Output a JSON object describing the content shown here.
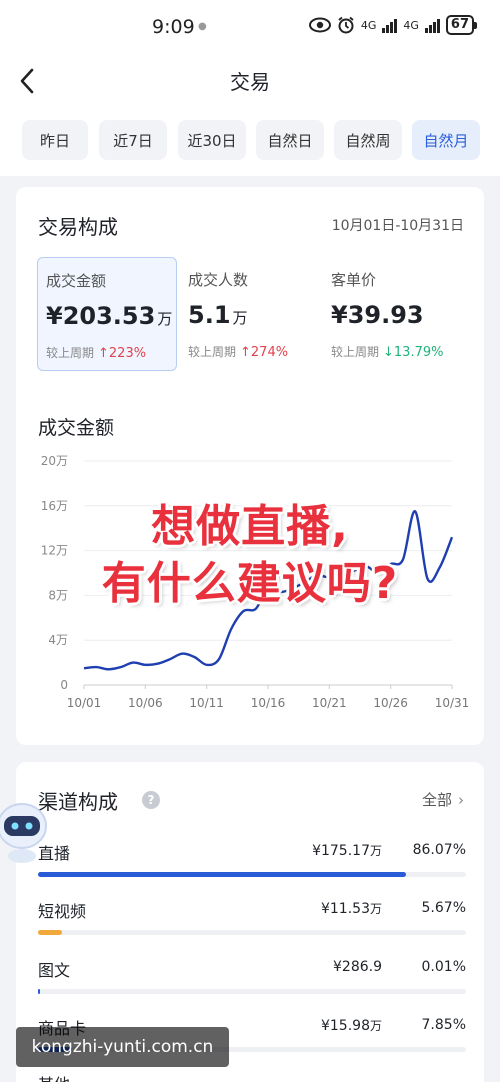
{
  "status_bar": {
    "time": "9:09",
    "signal_label_1": "4G",
    "signal_label_2": "4G",
    "battery": "67"
  },
  "header": {
    "title": "交易"
  },
  "tabs": [
    {
      "label": "昨日",
      "active": false
    },
    {
      "label": "近7日",
      "active": false
    },
    {
      "label": "近30日",
      "active": false
    },
    {
      "label": "自然日",
      "active": false
    },
    {
      "label": "自然周",
      "active": false
    },
    {
      "label": "自然月",
      "active": true
    }
  ],
  "composition": {
    "title": "交易构成",
    "date_range": "10月01日-10月31日",
    "metrics": [
      {
        "label": "成交金额",
        "value": "¥203.53",
        "unit": "万",
        "compare_label": "较上周期",
        "change": "↑223%",
        "direction": "up"
      },
      {
        "label": "成交人数",
        "value": "5.1",
        "unit": "万",
        "compare_label": "较上周期",
        "change": "↑274%",
        "direction": "up"
      },
      {
        "label": "客单价",
        "value": "¥39.93",
        "unit": "",
        "compare_label": "较上周期",
        "change": "↓13.79%",
        "direction": "down"
      }
    ]
  },
  "chart_data": {
    "type": "line",
    "title": "成交金额",
    "x": [
      "10/01",
      "10/02",
      "10/03",
      "10/04",
      "10/05",
      "10/06",
      "10/07",
      "10/08",
      "10/09",
      "10/10",
      "10/11",
      "10/12",
      "10/13",
      "10/14",
      "10/15",
      "10/16",
      "10/17",
      "10/18",
      "10/19",
      "10/20",
      "10/21",
      "10/22",
      "10/23",
      "10/24",
      "10/25",
      "10/26",
      "10/27",
      "10/28",
      "10/29",
      "10/30",
      "10/31"
    ],
    "series": [
      {
        "values": [
          1.5,
          1.6,
          1.4,
          1.6,
          2.0,
          1.8,
          1.9,
          2.3,
          2.8,
          2.5,
          1.8,
          2.3,
          5.0,
          6.6,
          6.8,
          8.6,
          8.3,
          8.6,
          9.2,
          9.8,
          9.6,
          9.9,
          10.2,
          10.6,
          10.0,
          10.8,
          11.2,
          15.5,
          9.5,
          10.5,
          13.2
        ],
        "color": "#1f3fb0"
      }
    ],
    "x_tick_labels": [
      "10/01",
      "10/06",
      "10/11",
      "10/16",
      "10/21",
      "10/26",
      "10/31"
    ],
    "y_tick_labels": [
      "0",
      "4万",
      "8万",
      "12万",
      "16万",
      "20万"
    ],
    "ylim": [
      0,
      20
    ],
    "grid": true
  },
  "overlay": {
    "line1": "想做直播,",
    "line2": "有什么建议吗?"
  },
  "channels": {
    "title": "渠道构成",
    "help_icon": "?",
    "all_label": "全部",
    "rows": [
      {
        "name": "直播",
        "amount": "¥175.17",
        "unit": "万",
        "percent": "86.07%",
        "share": 86.07,
        "color": "#2a5bd7"
      },
      {
        "name": "短视频",
        "amount": "¥11.53",
        "unit": "万",
        "percent": "5.67%",
        "share": 5.67,
        "color": "#f2a93b"
      },
      {
        "name": "图文",
        "amount": "¥286.9",
        "unit": "",
        "percent": "0.01%",
        "share": 0.01,
        "color": "#2a5bd7"
      },
      {
        "name": "商品卡",
        "amount": "¥15.98",
        "unit": "万",
        "percent": "7.85%",
        "share": 7.85,
        "color": "#2a5bd7"
      },
      {
        "name": "其他",
        "amount": "",
        "unit": "",
        "percent": "",
        "share": 0.0,
        "color": "#2a5bd7"
      }
    ]
  },
  "watermark": "kongzhi-yunti.com.cn"
}
